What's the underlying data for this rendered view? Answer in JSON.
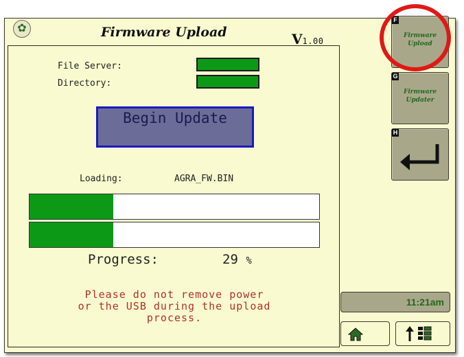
{
  "header": {
    "title": "Firmware Upload",
    "version_prefix": "V",
    "version_number": "1.00",
    "logo_icon": "deere-logo-icon"
  },
  "form": {
    "file_server_label": "File Server:",
    "directory_label": "Directory:",
    "begin_button_label": "Begin Update"
  },
  "loading": {
    "label": "Loading:",
    "filename": "AGRA_FW.BIN"
  },
  "progress": {
    "label": "Progress:",
    "value": "29",
    "unit": "%",
    "fraction": 0.29
  },
  "warning": {
    "line1": "Please do not remove power",
    "line2": "or the USB during the upload",
    "line3": "process."
  },
  "softkeys": [
    {
      "letter": "F",
      "line1": "Firmware",
      "line2": "Upload"
    },
    {
      "letter": "G",
      "line1": "Firmware",
      "line2": "Updater"
    },
    {
      "letter": "H",
      "icon": "back-arrow-icon"
    }
  ],
  "status": {
    "time": "11:21am"
  },
  "nav": {
    "home_icon": "home-icon",
    "menu_icon": "up-arrow-grid-icon"
  },
  "colors": {
    "background": "#fafad0",
    "progress_fill": "#0c9a16",
    "button_fill": "#6c6c98",
    "button_border": "#1a1ac0",
    "warning_text": "#b0302a",
    "softkey_fill": "#a9a78a",
    "highlight_ring": "#e01818"
  }
}
